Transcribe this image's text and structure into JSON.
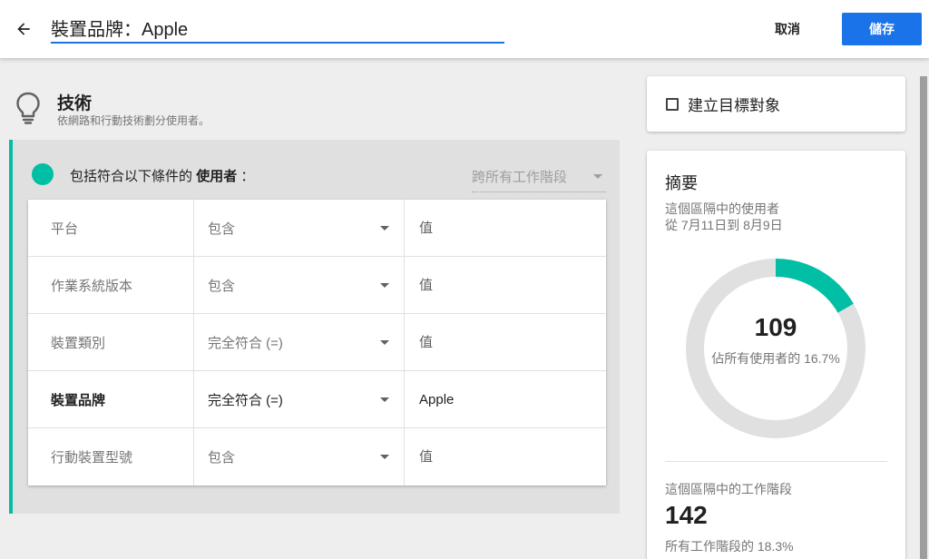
{
  "header": {
    "title_value": "裝置品牌：Apple",
    "cancel_label": "取消",
    "save_label": "儲存",
    "accent_color": "#1a73e8"
  },
  "section": {
    "icon": "lightbulb-icon",
    "title": "技術",
    "subtitle": "依網路和行動技術劃分使用者。"
  },
  "condition_group": {
    "label_prefix": "包括符合以下條件的",
    "label_subject": "使用者",
    "label_suffix": "：",
    "scope_label": "跨所有工作階段",
    "accent_color": "#00bfa5",
    "rows": [
      {
        "dimension": "平台",
        "operator": "包含",
        "value": "",
        "placeholder": "值"
      },
      {
        "dimension": "作業系統版本",
        "operator": "包含",
        "value": "",
        "placeholder": "值"
      },
      {
        "dimension": "裝置類別",
        "operator": "完全符合 (=)",
        "value": "",
        "placeholder": "值"
      },
      {
        "dimension": "裝置品牌",
        "operator": "完全符合 (=)",
        "value": "Apple",
        "placeholder": "值"
      },
      {
        "dimension": "行動裝置型號",
        "operator": "包含",
        "value": "",
        "placeholder": "值"
      }
    ]
  },
  "audience": {
    "checkbox_label": "建立目標對象",
    "checked": false
  },
  "summary": {
    "title": "摘要",
    "users_label": "這個區隔中的使用者",
    "date_range": "從 7月11日到 8月9日",
    "users_count": "109",
    "users_pct_label": "佔所有使用者的 16.7%",
    "users_fraction": 0.167,
    "sessions_label": "這個區隔中的工作階段",
    "sessions_count": "142",
    "sessions_pct_label": "所有工作階段的 18.3%",
    "donut_fill_color": "#00bfa5",
    "donut_track_color": "#e0e0e0"
  }
}
